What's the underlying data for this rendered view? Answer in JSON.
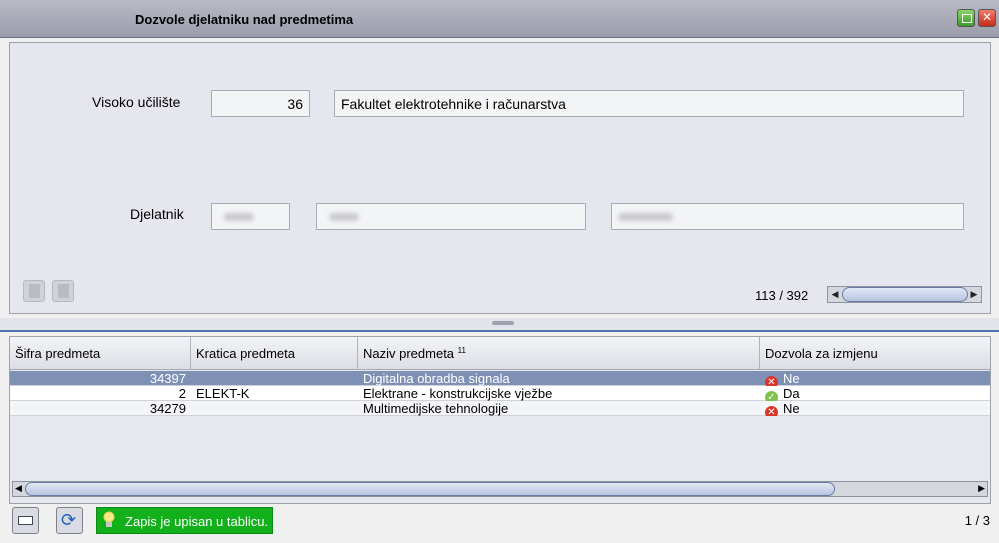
{
  "window": {
    "title": "Dozvole djelatniku nad predmetima"
  },
  "form": {
    "institution_label": "Visoko učilište",
    "institution_code": "36",
    "institution_name": "Fakultet elektrotehnike i računarstva",
    "employee_label": "Djelatnik"
  },
  "navigator": {
    "record_counter": "113 / 392"
  },
  "table": {
    "columns": [
      {
        "label": "Šifra predmeta"
      },
      {
        "label": "Kratica predmeta"
      },
      {
        "label": "Naziv predmeta",
        "sort_marker": "11"
      },
      {
        "label": "Dozvola za izmjenu"
      }
    ],
    "rows": [
      {
        "code": "34397",
        "abbr": "",
        "name": "Digitalna obradba signala",
        "permission": "Ne",
        "permission_icon": "red-x-icon",
        "selected": true
      },
      {
        "code": "2",
        "abbr": "ELEKT-K",
        "name": "Elektrane - konstrukcijske vježbe",
        "permission": "Da",
        "permission_icon": "green-check-icon",
        "selected": false
      },
      {
        "code": "34279",
        "abbr": "",
        "name": "Multimedijske tehnologije",
        "permission": "Ne",
        "permission_icon": "red-x-icon",
        "selected": false
      }
    ]
  },
  "status": {
    "message": "Zapis je upisan u tablicu.",
    "page": "1 / 3"
  },
  "colors": {
    "selected_row": "#7e91b4",
    "status_ok": "#12b01a",
    "accent": "#4c72b0"
  }
}
